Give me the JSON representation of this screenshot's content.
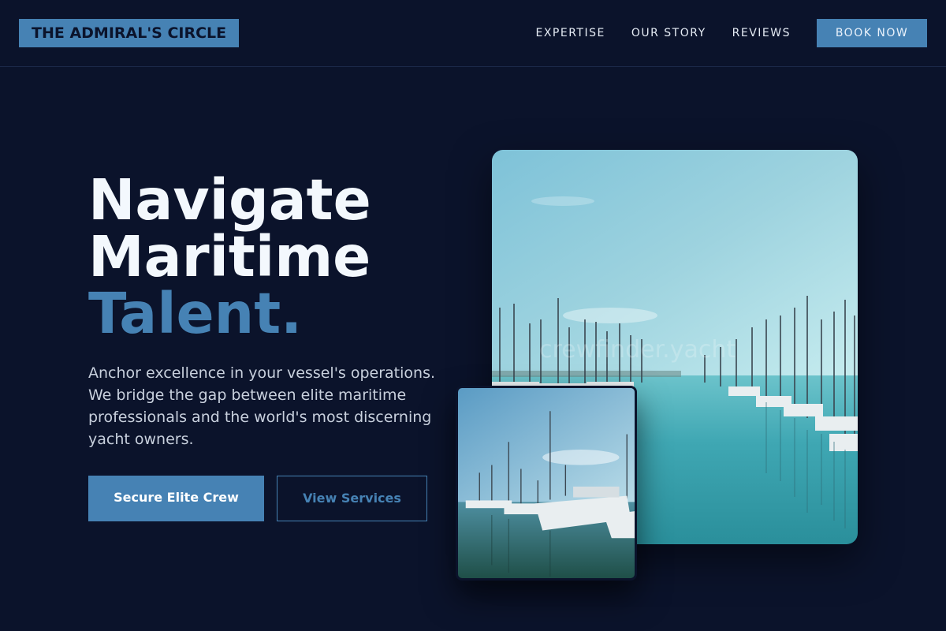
{
  "header": {
    "logo": "THE ADMIRAL'S CIRCLE",
    "nav": [
      "EXPERTISE",
      "OUR STORY",
      "REVIEWS"
    ],
    "cta": "BOOK NOW"
  },
  "hero": {
    "title_line1": "Navigate",
    "title_line2": "Maritime",
    "title_accent": "Talent.",
    "description": "Anchor excellence in your vessel's operations. We bridge the gap between elite maritime professionals and the world's most discerning yacht owners.",
    "primary_button": "Secure Elite Crew",
    "secondary_button": "View Services"
  },
  "images": {
    "large_alt": "Marina with sailboat masts and calm water",
    "small_alt": "Yachts docked at a harbor",
    "watermark": "crewfinder.yacht"
  },
  "colors": {
    "background": "#0b132b",
    "accent": "#4682b4",
    "text": "#ffffff",
    "muted_text": "#c8d0dd"
  }
}
